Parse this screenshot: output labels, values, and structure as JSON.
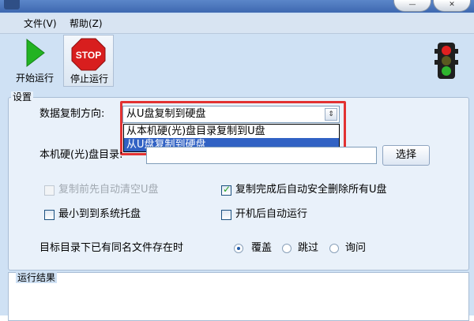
{
  "menu": {
    "file": "文件(V)",
    "help": "帮助(Z)"
  },
  "toolbar": {
    "start_label": "开始运行",
    "stop_label": "停止运行",
    "stop_sign_text": "STOP",
    "colors": {
      "start": "#22b322",
      "stop": "#d81e1e",
      "traffic_red": "#e02020",
      "traffic_green": "#2fb52f"
    }
  },
  "settings": {
    "group_title": "设置",
    "direction_label": "数据复制方向:",
    "direction_selected": "从U盘复制到硬盘",
    "direction_options": [
      "从本机硬(光)盘目录复制到U盘",
      "从U盘复制到硬盘"
    ],
    "local_dir_label": "本机硬(光)盘目录:",
    "local_dir_value": "",
    "select_button": "选择",
    "options": [
      {
        "label": "复制前先自动清空U盘",
        "checked": false,
        "enabled": false
      },
      {
        "label": "复制完成后自动安全删除所有U盘",
        "checked": true,
        "enabled": true
      },
      {
        "label": "最小到到系统托盘",
        "checked": false,
        "enabled": true
      },
      {
        "label": "开机后自动运行",
        "checked": false,
        "enabled": true
      }
    ],
    "conflict_label": "目标目录下已有同名文件存在时",
    "conflict_options": [
      {
        "label": "覆盖",
        "selected": true
      },
      {
        "label": "跳过",
        "selected": false
      },
      {
        "label": "询问",
        "selected": false
      }
    ]
  },
  "results": {
    "title": "运行结果"
  }
}
